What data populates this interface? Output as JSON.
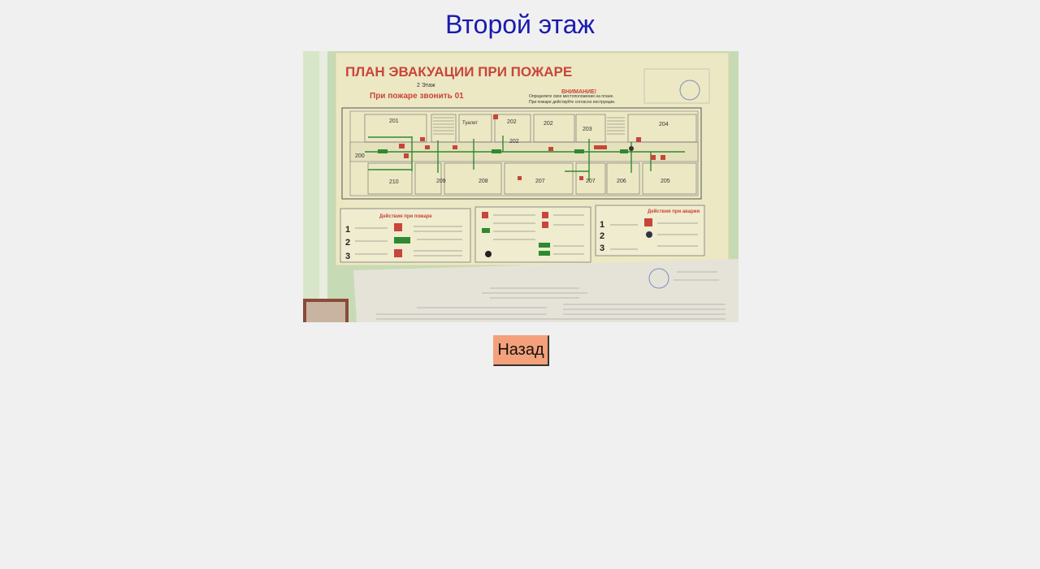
{
  "page": {
    "title": "Второй этаж"
  },
  "photo": {
    "plan_title": "ПЛАН ЭВАКУАЦИИ ПРИ ПОЖАРЕ",
    "floor": "2 Этаж",
    "call": "При пожаре звонить 01",
    "attention": "ВНИМАНИЕ!",
    "attention_text_1": "Определите свое местоположение на плане.",
    "attention_text_2": "При пожаре действуйте согласно инструкции.",
    "toilet": "Туалет",
    "rooms_top": [
      "201",
      "202",
      "202",
      "203",
      "204"
    ],
    "rooms_mid": [
      "200",
      "202"
    ],
    "rooms_bottom": [
      "210",
      "209",
      "208",
      "207",
      "207",
      "206",
      "205"
    ],
    "panel_left_title": "Действия при пожаре",
    "panel_right_title": "Действия при аварии",
    "steps": [
      "1",
      "2",
      "3"
    ]
  },
  "actions": {
    "back_label": "Назад"
  },
  "colors": {
    "title": "#1a1ab0",
    "button_bg": "#f4a07a",
    "plan_red": "#c8453a",
    "plan_green": "#2f8a2f"
  }
}
